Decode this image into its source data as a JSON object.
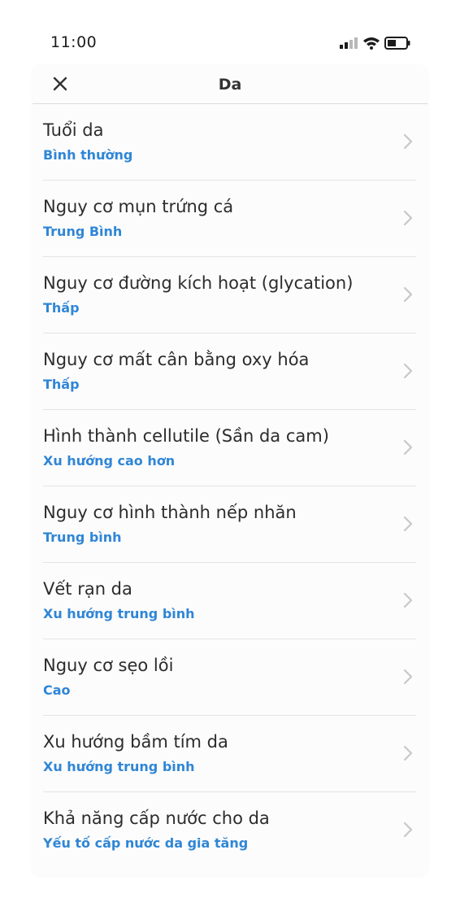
{
  "status_bar": {
    "time": "11:00",
    "icons": [
      "signal-icon",
      "wifi-icon",
      "battery-icon"
    ]
  },
  "header": {
    "title": "Da",
    "close_icon": "close-icon"
  },
  "colors": {
    "accent": "#2f86d6",
    "title_text": "#2c2c2c",
    "divider": "#e4e4e4",
    "chevron": "#c7c7cc"
  },
  "items": [
    {
      "title": "Tuổi da",
      "value": "Bình thường"
    },
    {
      "title": "Nguy cơ mụn trứng cá",
      "value": "Trung Bình"
    },
    {
      "title": "Nguy cơ đường kích hoạt (glycation)",
      "value": "Thấp"
    },
    {
      "title": "Nguy cơ mất cân bằng oxy hóa",
      "value": "Thấp"
    },
    {
      "title": "Hình thành cellutile (Sần da cam)",
      "value": "Xu hướng cao hơn"
    },
    {
      "title": "Nguy cơ hình thành nếp nhăn",
      "value": "Trung bình"
    },
    {
      "title": "Vết rạn da",
      "value": "Xu hướng trung bình"
    },
    {
      "title": "Nguy cơ sẹo lồi",
      "value": "Cao"
    },
    {
      "title": "Xu hướng bầm tím da",
      "value": "Xu hướng trung bình"
    },
    {
      "title": "Khả năng cấp nước cho da",
      "value": "Yếu tố cấp nước da gia tăng"
    }
  ]
}
